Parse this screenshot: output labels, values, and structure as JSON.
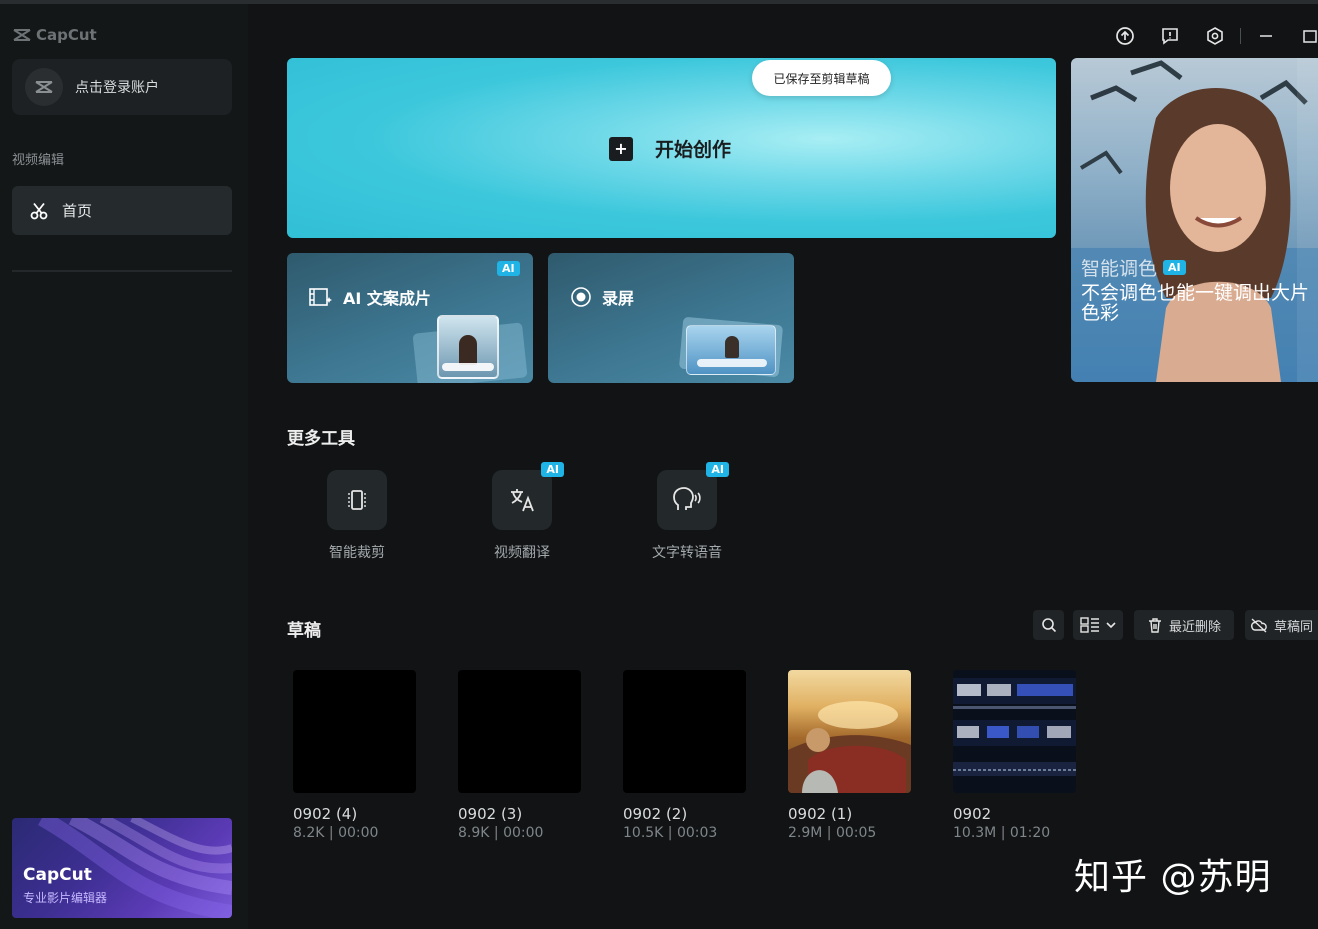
{
  "app": {
    "name": "CapCut"
  },
  "sidebar": {
    "login_label": "点击登录账户",
    "section_label": "视频编辑",
    "home_label": "首页",
    "promo": {
      "title": "CapCut",
      "subtitle": "专业影片编辑器"
    }
  },
  "window_controls": [
    "upload-icon",
    "feedback-icon",
    "settings-icon",
    "minimize-icon",
    "maximize-icon"
  ],
  "hero": {
    "badge": "已保存至剪辑草稿",
    "cta_label": "开始创作"
  },
  "tool_cards": [
    {
      "label": "AI 文案成片",
      "badge": "AI"
    },
    {
      "label": "录屏"
    }
  ],
  "side_promo": {
    "title": "智能调色",
    "badge": "AI",
    "description": "不会调色也能一键调出大片色彩"
  },
  "more_tools": {
    "heading": "更多工具",
    "items": [
      {
        "label": "智能裁剪",
        "icon": "crop-icon"
      },
      {
        "label": "视频翻译",
        "icon": "translate-icon",
        "badge": "AI"
      },
      {
        "label": "文字转语音",
        "icon": "text-to-speech-icon",
        "badge": "AI"
      }
    ]
  },
  "drafts": {
    "heading": "草稿",
    "toolbar": {
      "recent_delete": "最近删除",
      "cloud_sync": "草稿同"
    },
    "items": [
      {
        "name": "0902 (4)",
        "meta": "8.2K | 00:00",
        "thumb": "black"
      },
      {
        "name": "0902 (3)",
        "meta": "8.9K | 00:00",
        "thumb": "black"
      },
      {
        "name": "0902 (2)",
        "meta": "10.5K | 00:03",
        "thumb": "black"
      },
      {
        "name": "0902 (1)",
        "meta": "2.9M | 00:05",
        "thumb": "photo"
      },
      {
        "name": "0902",
        "meta": "10.3M | 01:20",
        "thumb": "text-frames"
      }
    ]
  },
  "watermark": "知乎 @苏明",
  "colors": {
    "accent": "#1fb3e6",
    "hero": "#3cc7dc",
    "background": "#111314"
  }
}
